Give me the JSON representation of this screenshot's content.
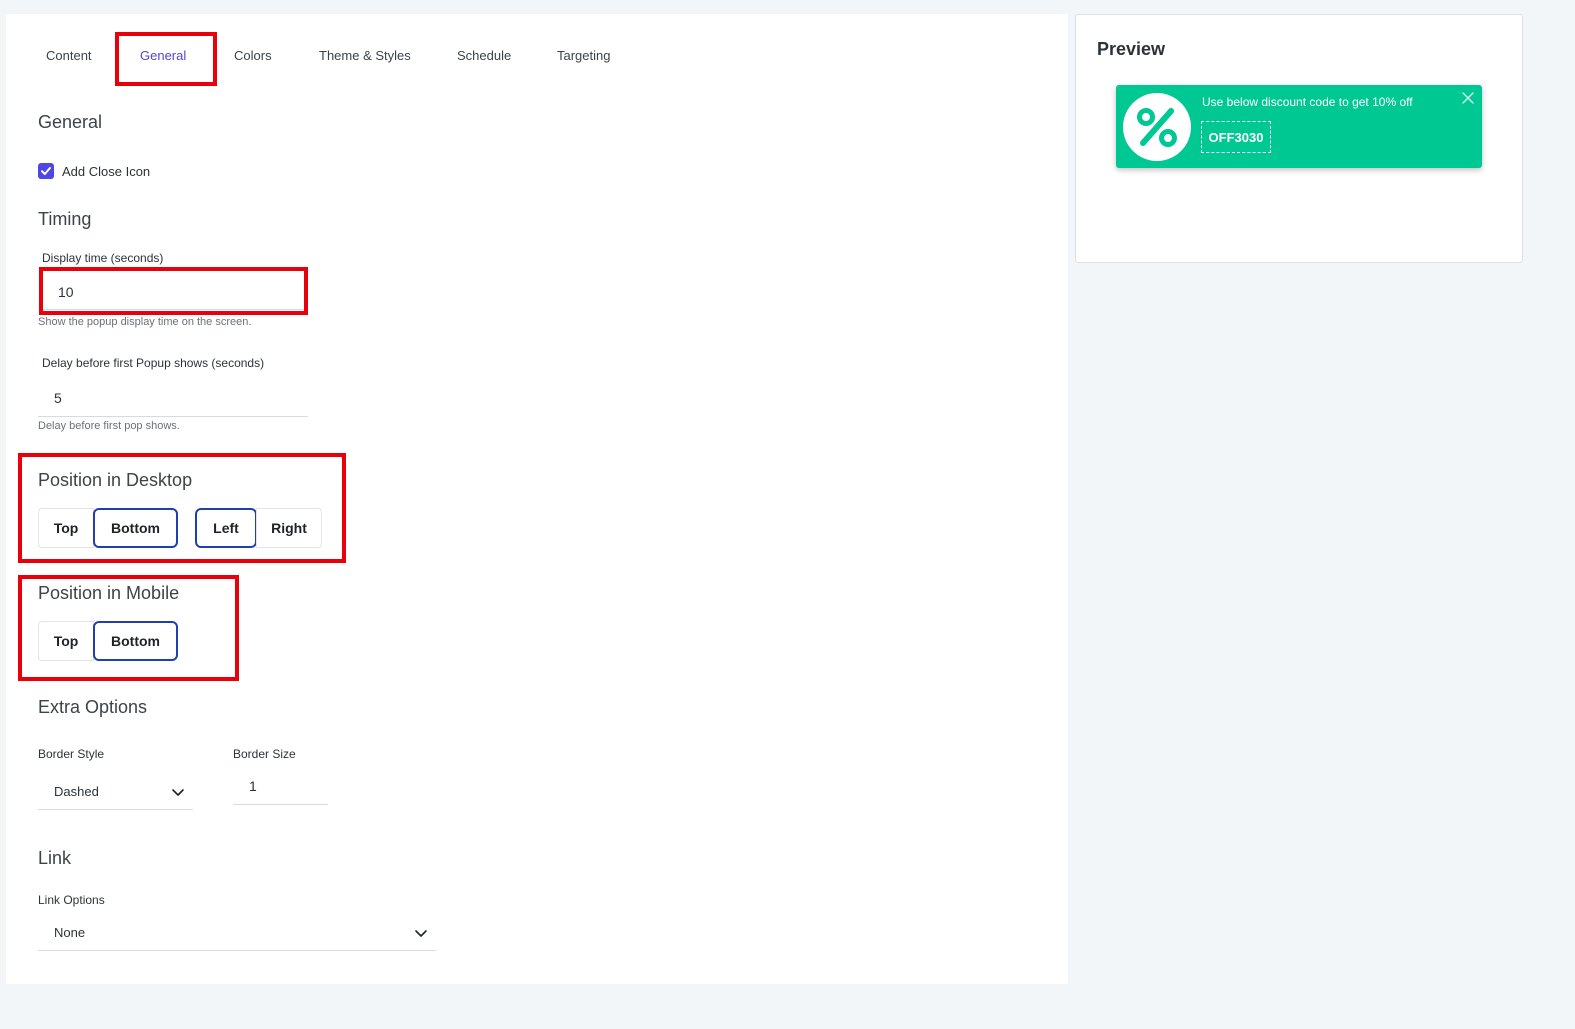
{
  "tabs": [
    {
      "label": "Content"
    },
    {
      "label": "General",
      "active": true
    },
    {
      "label": "Colors"
    },
    {
      "label": "Theme & Styles"
    },
    {
      "label": "Schedule"
    },
    {
      "label": "Targeting"
    }
  ],
  "general": {
    "heading": "General",
    "close_icon_label": "Add Close Icon",
    "close_icon_checked": true
  },
  "timing": {
    "heading": "Timing",
    "display_time_label": "Display time (seconds)",
    "display_time_value": "10",
    "display_time_help": "Show the popup display time on the screen.",
    "delay_label": "Delay before first Popup shows (seconds)",
    "delay_value": "5",
    "delay_help": "Delay before first pop shows."
  },
  "position_desktop": {
    "heading": "Position in Desktop",
    "vertical": [
      "Top",
      "Bottom"
    ],
    "vertical_selected": "Bottom",
    "horizontal": [
      "Left",
      "Right"
    ],
    "horizontal_selected": "Left"
  },
  "position_mobile": {
    "heading": "Position in Mobile",
    "vertical": [
      "Top",
      "Bottom"
    ],
    "vertical_selected": "Bottom"
  },
  "extra_options": {
    "heading": "Extra Options",
    "border_style_label": "Border Style",
    "border_style_value": "Dashed",
    "border_size_label": "Border Size",
    "border_size_value": "1"
  },
  "link": {
    "heading": "Link",
    "options_label": "Link Options",
    "options_value": "None"
  },
  "preview": {
    "title": "Preview",
    "message": "Use below discount code to get 10% off",
    "code": "OFF3030",
    "accent_color": "#00c893"
  },
  "colors": {
    "accent": "#5146d6",
    "highlight": "#e8000b",
    "selected_border": "#2040b0"
  }
}
